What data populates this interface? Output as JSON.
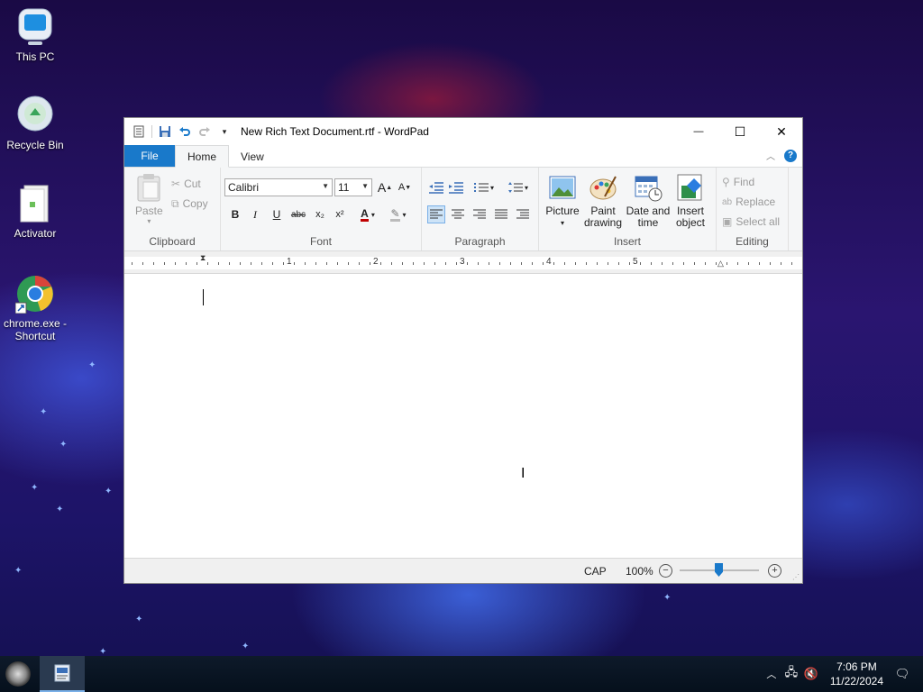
{
  "desktop": {
    "icons": [
      {
        "label": "This PC",
        "icon": "computer-icon"
      },
      {
        "label": "Recycle Bin",
        "icon": "recycle-bin-icon"
      },
      {
        "label": "Activator",
        "icon": "file-icon"
      },
      {
        "label": "chrome.exe - Shortcut",
        "icon": "chrome-icon"
      }
    ]
  },
  "window": {
    "title": "New Rich Text Document.rtf - WordPad",
    "controls": {
      "minimize": "—",
      "maximize": "☐",
      "close": "✕"
    }
  },
  "tabs": {
    "file": "File",
    "home": "Home",
    "view": "View"
  },
  "ribbon": {
    "clipboard": {
      "label": "Clipboard",
      "paste": "Paste",
      "cut": "Cut",
      "copy": "Copy"
    },
    "font": {
      "label": "Font",
      "family": "Calibri",
      "size": "11",
      "bold": "B",
      "italic": "I",
      "underline": "U",
      "strike": "abc",
      "subscript": "x₂",
      "superscript": "x²"
    },
    "paragraph": {
      "label": "Paragraph"
    },
    "insert": {
      "label": "Insert",
      "picture": "Picture",
      "paint_drawing": "Paint drawing",
      "date_time": "Date and time",
      "insert_object": "Insert object"
    },
    "editing": {
      "label": "Editing",
      "find": "Find",
      "replace": "Replace",
      "select_all": "Select all"
    }
  },
  "ruler": {
    "numbers": [
      "1",
      "2",
      "3",
      "4",
      "5"
    ]
  },
  "statusbar": {
    "caps": "CAP",
    "zoom": "100%",
    "zoom_minus": "−",
    "zoom_plus": "+"
  },
  "taskbar": {
    "time": "7:06 PM",
    "date": "11/22/2024"
  },
  "colors": {
    "accent": "#1979ca",
    "ribbon_bg": "#f5f6f7"
  }
}
